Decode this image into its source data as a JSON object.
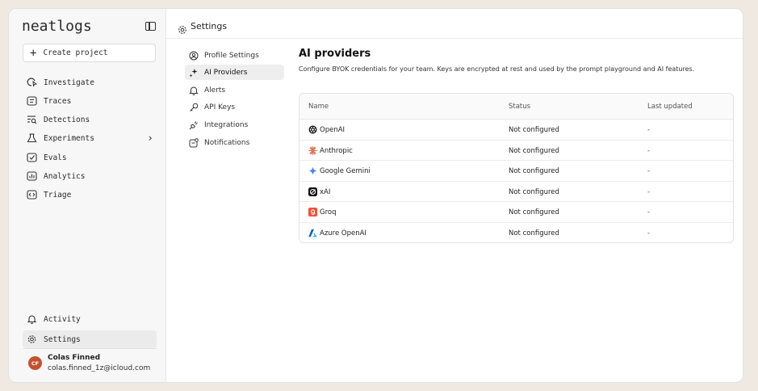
{
  "brand": "neatlogs",
  "sidebar": {
    "create_label": "Create project",
    "items": [
      {
        "label": "Investigate",
        "icon": "investigate-icon"
      },
      {
        "label": "Traces",
        "icon": "traces-icon"
      },
      {
        "label": "Detections",
        "icon": "detections-icon"
      },
      {
        "label": "Experiments",
        "icon": "flask-icon",
        "chevron": "›"
      },
      {
        "label": "Evals",
        "icon": "evals-icon"
      },
      {
        "label": "Analytics",
        "icon": "analytics-icon"
      },
      {
        "label": "Triage",
        "icon": "triage-icon"
      }
    ],
    "bottom_items": [
      {
        "label": "Activity",
        "icon": "bell-icon"
      },
      {
        "label": "Settings",
        "icon": "gear-icon"
      }
    ],
    "user": {
      "initials": "CF",
      "name": "Colas Finned",
      "email": "colas.finned_1z@icloud.com"
    }
  },
  "header": {
    "title": "Settings"
  },
  "settings_nav": [
    {
      "label": "Profile Settings",
      "icon": "user-circle-icon"
    },
    {
      "label": "AI Providers",
      "icon": "sparkles-icon"
    },
    {
      "label": "Alerts",
      "icon": "bell-icon"
    },
    {
      "label": "API Keys",
      "icon": "key-icon"
    },
    {
      "label": "Integrations",
      "icon": "plug-icon"
    },
    {
      "label": "Notifications",
      "icon": "notification-icon"
    }
  ],
  "main": {
    "title": "AI providers",
    "description": "Configure BYOK credentials for your team. Keys are encrypted at rest and used by the prompt playground and AI features.",
    "columns": [
      "Name",
      "Status",
      "Last updated"
    ],
    "rows": [
      {
        "name": "OpenAI",
        "status": "Not configured",
        "updated": "-",
        "icon": "openai-icon",
        "color": "#111111"
      },
      {
        "name": "Anthropic",
        "status": "Not configured",
        "updated": "-",
        "icon": "anthropic-icon",
        "color": "#d97757"
      },
      {
        "name": "Google Gemini",
        "status": "Not configured",
        "updated": "-",
        "icon": "gemini-icon",
        "color": "#4285f4"
      },
      {
        "name": "xAI",
        "status": "Not configured",
        "updated": "-",
        "icon": "xai-icon",
        "color": "#111111"
      },
      {
        "name": "Groq",
        "status": "Not configured",
        "updated": "-",
        "icon": "groq-icon",
        "color": "#f55036"
      },
      {
        "name": "Azure OpenAI",
        "status": "Not configured",
        "updated": "-",
        "icon": "azure-icon",
        "color": "#0078d4"
      }
    ]
  }
}
